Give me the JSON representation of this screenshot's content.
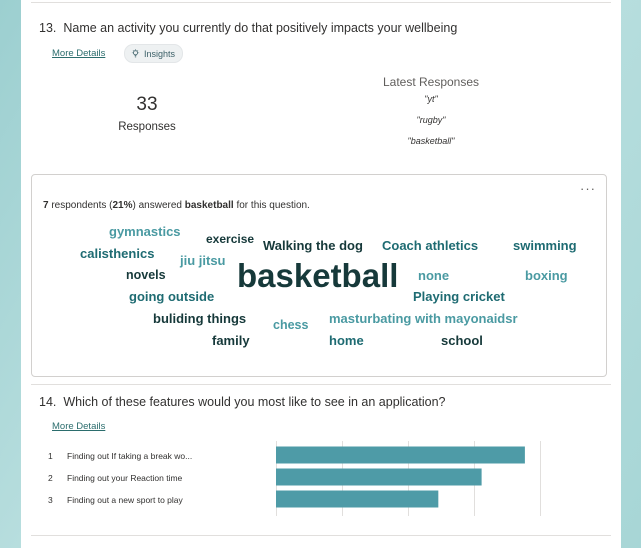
{
  "q13": {
    "number": "13.",
    "title": "Name an activity you currently do that positively impacts your wellbeing",
    "more_details": "More Details",
    "insights": "Insights",
    "responses_count": "33",
    "responses_label": "Responses",
    "latest_heading": "Latest Responses",
    "latest": [
      "\"yt\"",
      "\"rugby\"",
      "\"basketball\""
    ],
    "menu_icon": "more-icon",
    "summary": {
      "count": "7",
      "text1": " respondents (",
      "percent": "21%",
      "text2": ") answered ",
      "keyword": "basketball",
      "text3": " for this question."
    },
    "words": [
      {
        "text": "gymnastics",
        "color": "#4a9aa2",
        "size": 13
      },
      {
        "text": "exercise",
        "color": "#16393a",
        "size": 12
      },
      {
        "text": "Walking the dog",
        "color": "#16393a",
        "size": 13
      },
      {
        "text": "Coach athletics",
        "color": "#1e6b72",
        "size": 13
      },
      {
        "text": "swimming",
        "color": "#1e6b72",
        "size": 13
      },
      {
        "text": "calisthenics",
        "color": "#1e6b72",
        "size": 13
      },
      {
        "text": "jiu jitsu",
        "color": "#4a9aa2",
        "size": 13
      },
      {
        "text": "basketball",
        "color": "#16393a",
        "size": 33
      },
      {
        "text": "novels",
        "color": "#16393a",
        "size": 12.5
      },
      {
        "text": "none",
        "color": "#4a9aa2",
        "size": 13
      },
      {
        "text": "boxing",
        "color": "#4a9aa2",
        "size": 13
      },
      {
        "text": "going outside",
        "color": "#1e6b72",
        "size": 13
      },
      {
        "text": "Playing cricket",
        "color": "#1e6b72",
        "size": 13
      },
      {
        "text": "buliding things",
        "color": "#16393a",
        "size": 13
      },
      {
        "text": "chess",
        "color": "#4a9aa2",
        "size": 12.5
      },
      {
        "text": "masturbating with mayonaidsr",
        "color": "#4a9aa2",
        "size": 13
      },
      {
        "text": "family",
        "color": "#16393a",
        "size": 13
      },
      {
        "text": "home",
        "color": "#1e6b72",
        "size": 13
      },
      {
        "text": "school",
        "color": "#16393a",
        "size": 13
      }
    ]
  },
  "q14": {
    "number": "14.",
    "title": "Which of these features would you most like to see in an application?",
    "more_details": "More Details",
    "rows": [
      {
        "num": "1",
        "label": "Finding out If taking a break wo..."
      },
      {
        "num": "2",
        "label": "Finding out your Reaction time"
      },
      {
        "num": "3",
        "label": "Finding out a new sport to play"
      }
    ]
  },
  "chart_data": {
    "type": "bar",
    "categories": [
      "Finding out If taking a break wo...",
      "Finding out your Reaction time",
      "Finding out a new sport to play"
    ],
    "values": [
      23,
      19,
      15
    ],
    "xlim": [
      0,
      28
    ],
    "grid": true,
    "bar_color": "#4e9ba7"
  }
}
